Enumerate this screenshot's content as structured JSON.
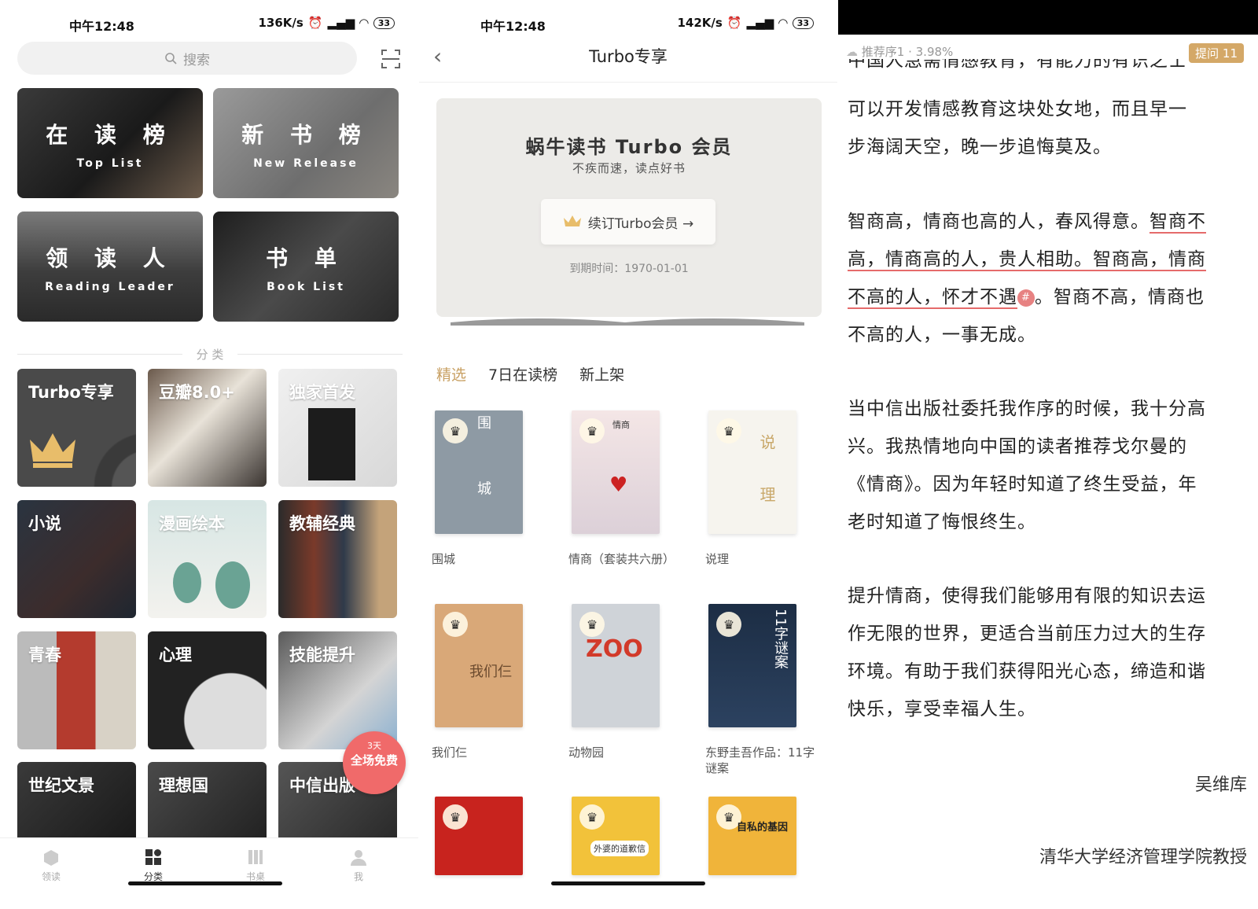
{
  "screen1": {
    "status": {
      "time": "中午12:48",
      "speed": "136K/s",
      "battery": "33"
    },
    "search_placeholder": "搜索",
    "features": [
      {
        "title": "在 读 榜",
        "subtitle": "Top List"
      },
      {
        "title": "新 书 榜",
        "subtitle": "New Release"
      },
      {
        "title": "领 读 人",
        "subtitle": "Reading Leader"
      },
      {
        "title": "书 单",
        "subtitle": "Book List"
      }
    ],
    "section_label": "分 类",
    "categories": [
      "Turbo专享",
      "豆瓣8.0+",
      "独家首发",
      "小说",
      "漫画绘本",
      "教辅经典",
      "青春",
      "心理",
      "技能提升",
      "世纪文景",
      "理想国",
      "中信出版"
    ],
    "promo_badge": {
      "line1": "3天",
      "line2": "全场免费"
    },
    "tabs": [
      "领读",
      "分类",
      "书桌",
      "我"
    ]
  },
  "screen2": {
    "status": {
      "time": "中午12:48",
      "speed": "142K/s",
      "battery": "33"
    },
    "nav_title": "Turbo专享",
    "banner": {
      "title": "蜗牛读书 Turbo 会员",
      "slogan": "不疾而速，读点好书",
      "renew_button": "续订Turbo会员 →",
      "expiry": "到期时间：1970-01-01"
    },
    "tabs": [
      "精选",
      "7日在读榜",
      "新上架"
    ],
    "active_tab": "精选",
    "books": [
      {
        "name": "围城",
        "cover_text": "围 城"
      },
      {
        "name": "情商（套装共六册）",
        "cover_text": "情商"
      },
      {
        "name": "说理",
        "cover_text": "说 理"
      },
      {
        "name": "我们仨",
        "cover_text": "我们仨"
      },
      {
        "name": "动物园",
        "cover_text": "ZOO"
      },
      {
        "name": "东野圭吾作品：11字谜案",
        "cover_text": "11字谜案"
      },
      {
        "name": "",
        "cover_text": ""
      },
      {
        "name": "",
        "cover_text": "外婆的道歉信"
      },
      {
        "name": "",
        "cover_text": "自私的基因"
      }
    ],
    "accent": "#c8a063"
  },
  "screen3": {
    "header": {
      "info": "推荐序1 · 3.98%",
      "ask": "提问 11"
    },
    "cut_line": "中国人急需情感教育，有能力的有识之士",
    "p1": [
      "可以开发情感教育这块处女地，而且早一",
      "步海阔天空，晚一步追悔莫及。"
    ],
    "p2a": "智商高，情商也高的人，春风得意。",
    "p2b": "智商不高，情商高的人，贵人相助。智商高，情商不高的人，怀才不遇",
    "p2c": "。智商不高，情商也不高的人，一事无成。",
    "p3": "当中信出版社委托我作序的时候，我十分高兴。我热情地向中国的读者推荐戈尔曼的《情商》。因为年轻时知道了终生受益，年老时知道了悔恨终生。",
    "p4": "提升情商，使得我们能够用有限的知识去运作无限的世界，更适合当前压力过大的生存环境。有助于我们获得阳光心态，缔造和谐快乐，享受幸福人生。",
    "author": "吴维库",
    "author_title": "清华大学经济管理学院教授",
    "accent": "#d4a867",
    "underline_color": "#e56b6b"
  }
}
